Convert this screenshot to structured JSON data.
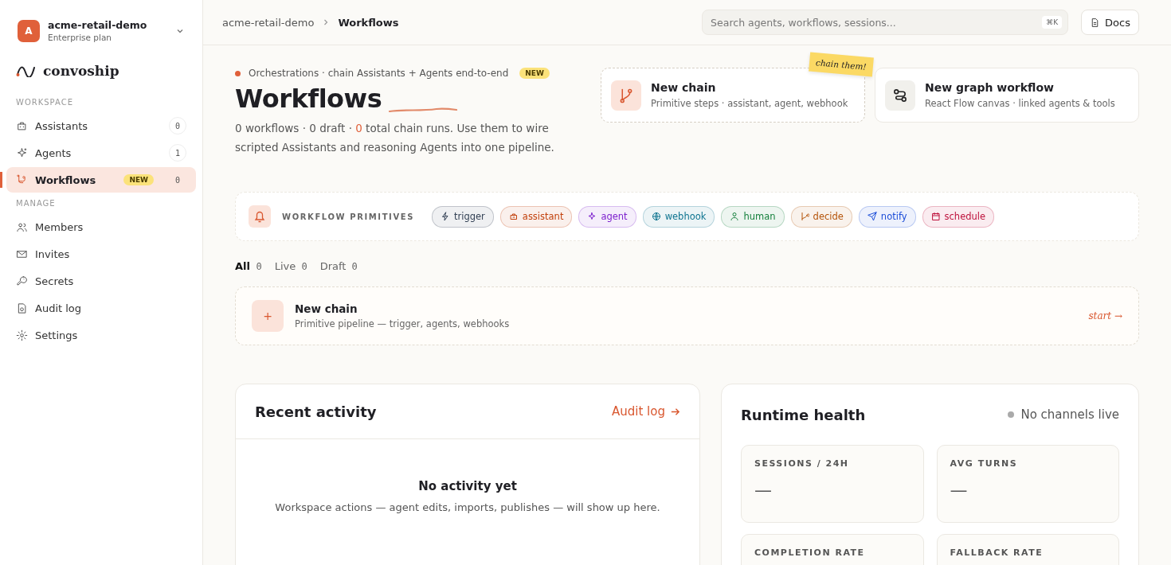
{
  "workspace": {
    "initial": "A",
    "name": "acme-retail-demo",
    "plan": "Enterprise plan"
  },
  "brand": "convoship",
  "sidebar": {
    "sections": [
      {
        "heading": "WORKSPACE",
        "items": [
          {
            "label": "Assistants",
            "count": "0",
            "selected": false
          },
          {
            "label": "Agents",
            "count": "1",
            "selected": false
          },
          {
            "label": "Workflows",
            "badge": "NEW",
            "count": "0",
            "selected": true
          }
        ]
      },
      {
        "heading": "MANAGE",
        "items": [
          {
            "label": "Members",
            "selected": false
          },
          {
            "label": "Invites",
            "selected": false
          },
          {
            "label": "Secrets",
            "selected": false
          },
          {
            "label": "Audit log",
            "selected": false
          },
          {
            "label": "Settings",
            "selected": false
          }
        ]
      }
    ]
  },
  "breadcrumb": [
    "acme-retail-demo",
    "Workflows"
  ],
  "search": {
    "placeholder": "Search agents, workflows, sessions...",
    "shortcut": "⌘K"
  },
  "docs_button": "Docs",
  "hero": {
    "eyebrow": "Orchestrations · chain Assistants + Agents end-to-end",
    "badge": "NEW",
    "title": "Workflows",
    "summary_start": "0 workflows · 0 draft · ",
    "runs": "0",
    "summary_end": " total chain runs. Use them to wire scripted Assistants and reasoning Agents into one pipeline."
  },
  "actions": [
    {
      "title": "New chain",
      "subtitle": "Primitive steps · assistant, agent, webhook",
      "sticky_note": "chain them!"
    },
    {
      "title": "New graph workflow",
      "subtitle": "React Flow canvas · linked agents & tools"
    }
  ],
  "primitives": {
    "label": "WORKFLOW PRIMITIVES",
    "chips": [
      {
        "label": "trigger",
        "color": "#334155"
      },
      {
        "label": "assistant",
        "color": "#c2410c"
      },
      {
        "label": "agent",
        "color": "#7e22ce"
      },
      {
        "label": "webhook",
        "color": "#0e7490"
      },
      {
        "label": "human",
        "color": "#15803d"
      },
      {
        "label": "decide",
        "color": "#b45309"
      },
      {
        "label": "notify",
        "color": "#1d4ed8"
      },
      {
        "label": "schedule",
        "color": "#be123c"
      }
    ]
  },
  "filters": [
    {
      "label": "All",
      "count": "0",
      "selected": true
    },
    {
      "label": "Live",
      "count": "0",
      "selected": false
    },
    {
      "label": "Draft",
      "count": "0",
      "selected": false
    }
  ],
  "new_chain_row": {
    "plus": "+",
    "title": "New chain",
    "subtitle": "Primitive pipeline — trigger, agents, webhooks",
    "cta": "start →"
  },
  "recent_activity": {
    "title": "Recent activity",
    "link": "Audit log",
    "empty_title": "No activity yet",
    "empty_text": "Workspace actions — agent edits, imports, publishes — will show up here."
  },
  "runtime_health": {
    "title": "Runtime health",
    "status": "No channels live",
    "metrics": [
      {
        "label": "SESSIONS / 24H",
        "value": "—"
      },
      {
        "label": "AVG TURNS",
        "value": "—"
      },
      {
        "label": "COMPLETION RATE"
      },
      {
        "label": "FALLBACK RATE"
      }
    ]
  }
}
